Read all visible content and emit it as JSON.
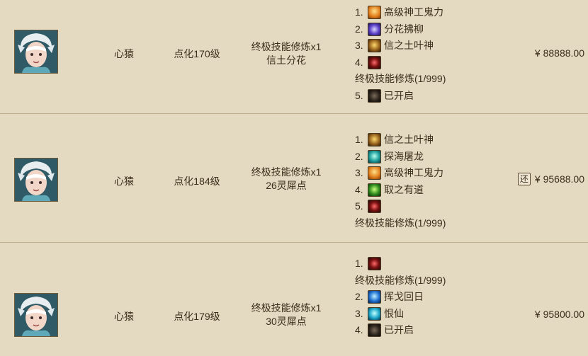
{
  "rows": [
    {
      "role": "心猿",
      "level": "点化170级",
      "skill_line1": "终极技能修炼x1",
      "skill_line2": "信土分花",
      "skills": [
        {
          "num": "1.",
          "icon": "golden-fire-icon",
          "name": "高级神工鬼力"
        },
        {
          "num": "2.",
          "icon": "purple-flower-icon",
          "name": "分花拂柳"
        },
        {
          "num": "3.",
          "icon": "amber-leaf-icon",
          "name": "信之土叶神"
        },
        {
          "num": "4.",
          "icon": "red-rune-icon",
          "name": ""
        },
        {
          "num": "",
          "icon": "",
          "name": "终极技能修炼(1/999)"
        },
        {
          "num": "5.",
          "icon": "dark-seal-icon",
          "name": "已开启"
        }
      ],
      "price": "¥ 88888.00",
      "has_return_badge": false
    },
    {
      "role": "心猿",
      "level": "点化184级",
      "skill_line1": "终极技能修炼x1",
      "skill_line2": "26灵犀点",
      "skills": [
        {
          "num": "1.",
          "icon": "amber-leaf-icon",
          "name": "信之土叶神"
        },
        {
          "num": "2.",
          "icon": "teal-dragon-icon",
          "name": "探海屠龙"
        },
        {
          "num": "3.",
          "icon": "golden-fire-icon",
          "name": "高级神工鬼力"
        },
        {
          "num": "4.",
          "icon": "green-sprout-icon",
          "name": "取之有道"
        },
        {
          "num": "5.",
          "icon": "red-rune-icon",
          "name": ""
        },
        {
          "num": "",
          "icon": "",
          "name": "终极技能修炼(1/999)"
        }
      ],
      "price": "¥ 95688.00",
      "return_badge": "还",
      "has_return_badge": true
    },
    {
      "role": "心猿",
      "level": "点化179级",
      "skill_line1": "终极技能修炼x1",
      "skill_line2": "30灵犀点",
      "skills": [
        {
          "num": "1.",
          "icon": "red-rune-icon",
          "name": ""
        },
        {
          "num": "",
          "icon": "",
          "name": "终极技能修炼(1/999)"
        },
        {
          "num": "2.",
          "icon": "blue-feather-icon",
          "name": "挥戈回日"
        },
        {
          "num": "3.",
          "icon": "cyan-flame-icon",
          "name": "恨仙"
        },
        {
          "num": "4.",
          "icon": "dark-seal-icon",
          "name": "已开启"
        }
      ],
      "price": "¥ 95800.00",
      "has_return_badge": false
    }
  ],
  "colors": {
    "background": "#e4dac1",
    "divider": "#bcae8c",
    "text": "#3a2e1c"
  }
}
